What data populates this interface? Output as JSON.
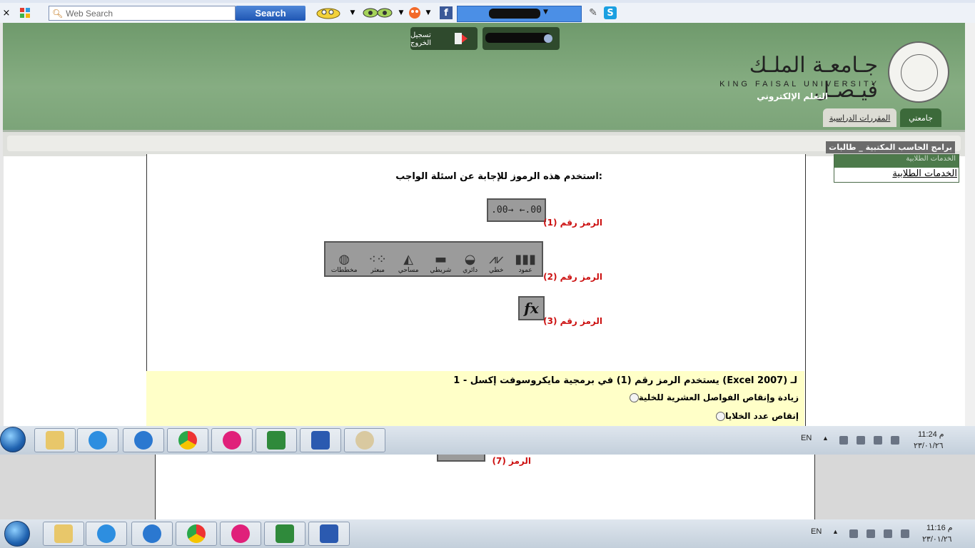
{
  "toolbar": {
    "close_glyph": "×",
    "search_placeholder": "Web Search",
    "search_button": "Search",
    "facebook_label": "f",
    "skype_label": "S"
  },
  "header": {
    "logout_label": "تسجيل الخروج",
    "university_ar": "جـامعـة الملـك فيـصـل",
    "university_en": "KING FAISAL UNIVERSITY",
    "elearning": "التعلم الإلكتروني",
    "tabs": [
      {
        "label": "جامعتي",
        "active": true
      },
      {
        "label": "المقررات الدراسية",
        "active": false
      }
    ],
    "breadcrumb": "برامج الحاسب المكتبية _ طالبات"
  },
  "sidebar": {
    "group_title": "الخدمات الطلابية",
    "link": "الخدمات الطلابية"
  },
  "content": {
    "instruction": "استخدم هذه الرموز للإجابة عن اسئلة الواجب:",
    "symbols": [
      {
        "label": "الرمز رقم (1)",
        "glyphs": [
          "←.00",
          ".00→"
        ]
      },
      {
        "label": "الرمز رقم (2)",
        "charts": [
          {
            "name": "عمود",
            "icon": "column-chart-icon"
          },
          {
            "name": "خطي",
            "icon": "line-chart-icon"
          },
          {
            "name": "دائري",
            "icon": "pie-chart-icon"
          },
          {
            "name": "شريطي",
            "icon": "bar-chart-icon"
          },
          {
            "name": "مساحي",
            "icon": "area-chart-icon"
          },
          {
            "name": "مبعثر",
            "icon": "scatter-chart-icon"
          },
          {
            "name": "مخططات",
            "icon": "donut-chart-icon"
          }
        ]
      },
      {
        "label": "الرمز رقم (3)",
        "glyph": "fx"
      }
    ],
    "question": {
      "text": "1 - يستخدم الرمز رقم (1) في برمجية مايكروسوفت إكسل (Excel 2007) لـ",
      "options": [
        "زيادة وإنقاص الفواصل العشرية للخلية",
        "إنقاص عدد الخلايا"
      ]
    },
    "symbol7_label": "الرمز (7)"
  },
  "taskbar_top": {
    "lang": "EN",
    "time": "11:24 م",
    "date": "٢٣/٠١/٢٦"
  },
  "taskbar_bottom": {
    "lang": "EN",
    "time": "11:16 م",
    "date": "٢٣/٠١/٢٦"
  },
  "colors": {
    "header_green": "#7ea57b",
    "tab_active": "#3c6a3a",
    "question_bg": "#ffffc8",
    "symbol_label_red": "#cc1010"
  }
}
